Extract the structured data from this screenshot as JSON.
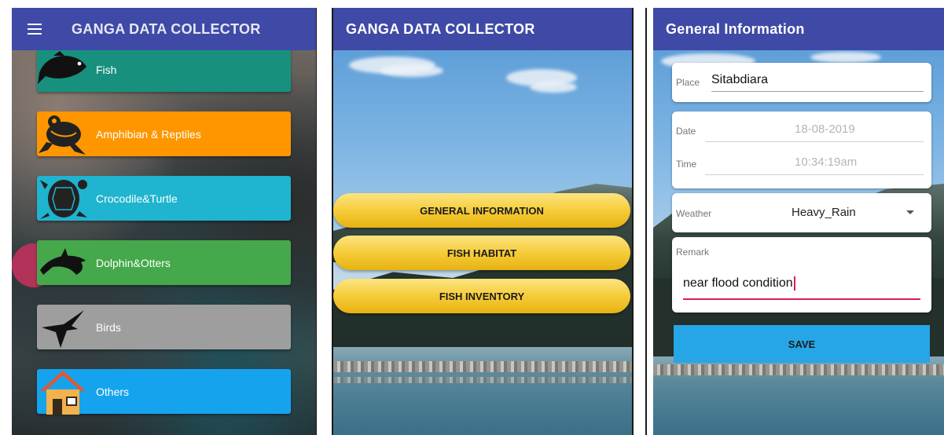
{
  "screen1": {
    "title": "GANGA DATA COLLECTOR",
    "categories": [
      {
        "label": "Fish",
        "color": "#17917e",
        "icon": "fish-icon"
      },
      {
        "label": "Amphibian & Reptiles",
        "color": "#ff9600",
        "icon": "frog-icon"
      },
      {
        "label": "Crocodile&Turtle",
        "color": "#1fb4cf",
        "icon": "turtle-icon"
      },
      {
        "label": "Dolphin&Otters",
        "color": "#45a84b",
        "icon": "dolphin-icon"
      },
      {
        "label": "Birds",
        "color": "#9e9e9e",
        "icon": "bird-icon"
      },
      {
        "label": "Others",
        "color": "#16a3ee",
        "icon": "house-icon"
      }
    ]
  },
  "screen2": {
    "title": "GANGA DATA COLLECTOR",
    "buttons": [
      {
        "label": "GENERAL INFORMATION"
      },
      {
        "label": "FISH HABITAT"
      },
      {
        "label": "FISH INVENTORY"
      }
    ]
  },
  "screen3": {
    "title": "General Information",
    "place": {
      "label": "Place",
      "value": "Sitabdiara"
    },
    "date": {
      "label": "Date",
      "value": "18-08-2019"
    },
    "time": {
      "label": "Time",
      "value": "10:34:19am"
    },
    "weather": {
      "label": "Weather",
      "value": "Heavy_Rain"
    },
    "remark": {
      "label": "Remark",
      "value": "near flood condition"
    },
    "save_label": "SAVE"
  },
  "colors": {
    "appbar": "#3f4aa6",
    "accent_pink": "#d81b60",
    "save_button": "#26a6e6",
    "pill_yellow": "#f6cc3a"
  }
}
